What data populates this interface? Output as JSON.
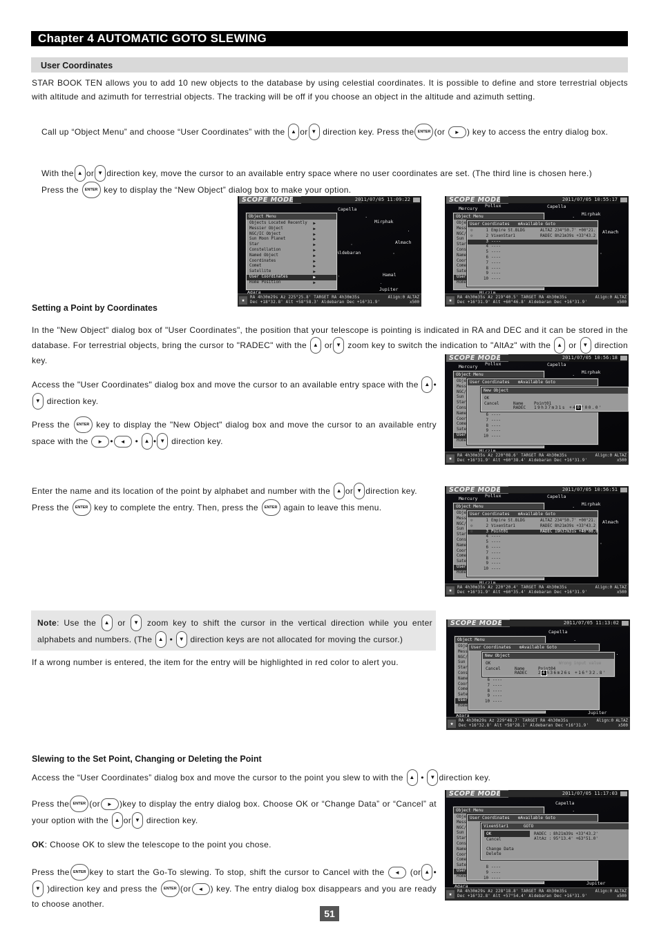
{
  "chapter_title": "Chapter 4  AUTOMATIC GOTO SLEWING",
  "section_title": "User Coordinates",
  "keys": {
    "up": "▲",
    "down": "▼",
    "right": "►",
    "left": "◄",
    "enter": "ENTER"
  },
  "intro": "STAR BOOK TEN allows you to add 10 new objects to the database by using celestial coordinates.  It is possible to define and store terrestrial objects with altitude and azimuth for terrestrial objects.  The tracking will be off if you choose an object in the altitude and azimuth setting.",
  "step1": {
    "a": "Call up “Object Menu” and choose “User Coordinates” with the",
    "b": "or",
    "c": "direction key.  Press the",
    "d": "(or",
    "e": ") key to access the entry dialog box."
  },
  "step2": {
    "a": "With the",
    "b": "or",
    "c": "direction key, move the cursor to an available entry space where no user coordinates are set.  (The third line is chosen here.)",
    "d": "Press the",
    "e": "key to display the “New Object” dialog box to make your option."
  },
  "setting_heading": "Setting a Point by Coordinates",
  "setting": {
    "p1a": "In the \"New Object\" dialog box of \"User Coordinates\", the position that your telescope is pointing is indicated in RA and DEC and it can be stored in the database.  For terrestrial objects, bring the cursor to \"RADEC\" with the",
    "p1b": "or",
    "p1c": "zoom key to switch the indication to \"AltAz\" with the",
    "p1d": "or",
    "p1e": "direction key.",
    "p2a": "Access the \"User Coordinates\" dialog box and move the cursor to an available entry space with the",
    "p2b": "•",
    "p2c": "direction key.",
    "p3a": "Press the",
    "p3b": "key to display the \"New Object\" dialog box and move the cursor to an available entry space with the",
    "p3c": "•",
    "p3d": "direction key.",
    "p4a": "Enter the name and its location of the point by alphabet and number with the",
    "p4b": "or",
    "p4c": "direction key.",
    "p4d": "Press the",
    "p4e": "key to complete the entry.  Then, press the",
    "p4f": "again to leave this menu."
  },
  "note": {
    "label": "Note",
    "a": ": Use the",
    "b": "or",
    "c": "zoom key to shift the cursor in the vertical direction while you enter alphabets and numbers.  (The",
    "d": "•",
    "e": "direction keys are not allocated for moving the cursor.)"
  },
  "wrong_number": "If a wrong number is entered, the item for the entry will be highlighted in red color to alert you.",
  "slewing_heading": "Slewing to the Set Point, Changing or Deleting the Point",
  "slewing": {
    "p1a": "Access the “User Coordinates” dialog box and move the cursor to the point you slew to with the",
    "p1b": "•",
    "p1c": "direction key.",
    "p2a": "Press the",
    "p2b": "(or",
    "p2c": ")key to display the entry dialog box.  Choose OK or “Change Data” or “Cancel” at your option with the",
    "p2d": "or",
    "p2e": "direction key.",
    "ok_label": "OK",
    "ok_text": ": Choose OK to slew the telescope to the point you chose.",
    "p3a": "Press the",
    "p3b": "key to start the Go-To slewing.  To stop, shift the cursor to Cancel with the",
    "p3c": "(or",
    "p3d": "•",
    "p3e": ")direction key and press the",
    "p3f": "(or",
    "p3g": ") key.  The entry dialog box disappears and you are ready to choose another."
  },
  "page_number": "51",
  "screens": {
    "mode_label": "SCOPE MODE",
    "object_menu_title": "Object Menu",
    "object_menu_items": [
      "Objects Located Recently",
      "Messier Object",
      "NGC/IC Object",
      "Sun Moon Planet",
      "Star",
      "Constellation",
      "Named Object",
      "Coordinates",
      "Comet",
      "Satellite",
      "User Coordinates",
      "Home Position"
    ],
    "object_menu_short": [
      "Obje",
      "Mess",
      "NGC/",
      "Sun",
      "Star",
      "Cons",
      "Name",
      "Coor",
      "Come",
      "Sate",
      "User",
      "Home"
    ],
    "uc_title": "User Coordinates",
    "uc_available": "Available Goto",
    "star_labels": [
      "Capella",
      "Mirphak",
      "Almach",
      "Aldebaran",
      "Hamal",
      "Jupiter",
      "Adara",
      "Mercury",
      "Pollux",
      "Mirzim"
    ],
    "s1": {
      "clock": "2011/07/05 11:09:22",
      "status_row1": "RA  4h30m29s  Az 225°25.8'     TARGET   RA  4h30m35s",
      "status_row2": "Dec +18°32.8'  Alt +58°58.3'  Aldebaran Dec +16°31.9'",
      "align": "Align:0  ALTAZ",
      "zoom": "x500",
      "selected_index": 10
    },
    "s2": {
      "clock": "2011/07/05 10:55:17",
      "status_row1": "RA  4h30m35s  Az 219°40.5'     TARGET   RA  4h30m35s",
      "status_row2": "Dec +16°31.9'  Alt +60°46.8'  Aldebaran Dec +16°31.9'",
      "align": "Align:0  ALTAZ",
      "zoom": "x500",
      "entries": [
        {
          "num": "1",
          "name": "Empire St.BLDG",
          "coord": "ALTAZ  234°50.7'  +00°21."
        },
        {
          "num": "2",
          "name": "VixenStar1",
          "coord": "RADEC   8h21m39s  +33°43.2"
        },
        {
          "num": "3",
          "name": "----",
          "coord": ""
        },
        {
          "num": "4",
          "name": "----",
          "coord": ""
        },
        {
          "num": "5",
          "name": "----",
          "coord": ""
        },
        {
          "num": "6",
          "name": "----",
          "coord": ""
        },
        {
          "num": "7",
          "name": "----",
          "coord": ""
        },
        {
          "num": "8",
          "name": "----",
          "coord": ""
        },
        {
          "num": "9",
          "name": "----",
          "coord": ""
        },
        {
          "num": "10",
          "name": "----",
          "coord": ""
        }
      ],
      "selected_index": 2
    },
    "s3": {
      "clock": "2011/07/05 10:56:18",
      "status_row1": "RA  4h30m35s  Az 220°08.6'     TARGET   RA  4h30m35s",
      "status_row2": "Dec +16°31.9'  Alt +60°38.4'  Aldebaran Dec +16°31.9'",
      "align": "Align:0  ALTAZ",
      "zoom": "x500",
      "new_object_title": "New Object",
      "ok": "OK",
      "cancel": "Cancel",
      "name_label": "Name",
      "name_value": "Point01",
      "radec_label": "RADEC",
      "radec_before": "19h37m31s +4",
      "radec_cursor": "0",
      "radec_after": "°00.0'"
    },
    "s4": {
      "clock": "2011/07/05 10:56:51",
      "status_row1": "RA  4h30m35s  Az 220°20.4'     TARGET   RA  4h30m35s",
      "status_row2": "Dec +16°31.9'  Alt +60°35.4'  Aldebaran Dec +16°31.9'",
      "align": "Align:0  ALTAZ",
      "zoom": "x500",
      "entries": [
        {
          "num": "1",
          "name": "Empire St.BLDG",
          "coord": "ALTAZ  234°50.7'  +00°21."
        },
        {
          "num": "2",
          "name": "VixenStar1",
          "coord": "RADEC   8h21m39s  +33°43.2"
        },
        {
          "num": "3",
          "name": "Point01",
          "coord": "RADEC  19h37m31s  +40°00.0"
        },
        {
          "num": "4",
          "name": "----",
          "coord": ""
        },
        {
          "num": "5",
          "name": "----",
          "coord": ""
        },
        {
          "num": "6",
          "name": "----",
          "coord": ""
        },
        {
          "num": "7",
          "name": "----",
          "coord": ""
        },
        {
          "num": "8",
          "name": "----",
          "coord": ""
        },
        {
          "num": "9",
          "name": "----",
          "coord": ""
        },
        {
          "num": "10",
          "name": "----",
          "coord": ""
        }
      ],
      "selected_index": 2
    },
    "s5": {
      "clock": "2011/07/05 11:13:02",
      "status_row1": "RA  4h30m29s  Az 229°48.7'     TARGET   RA  4h30m35s",
      "status_row2": "Dec +16°32.8'  Alt +58°28.1'  Aldebaran Dec +16°31.9'",
      "align": "Align:0  ALTAZ",
      "zoom": "x500",
      "new_object_title": "New Object",
      "ok": "OK",
      "cancel": "Cancel",
      "name_label": "Name",
      "name_value": "Point04",
      "radec_label": "RADEC",
      "radec_before": "2",
      "radec_cursor": "4",
      "radec_after": "h36m26s +16°32.8'",
      "hint": "Wrong input value"
    },
    "s6": {
      "clock": "2011/07/05 11:17:03",
      "status_row1": "RA  4h30m29s  Az 228°18.8'     TARGET   RA  4h30m35s",
      "status_row2": "Dec +16°32.8'  Alt +57°54.4'  Aldebaran Dec +16°31.9'",
      "align": "Align:0  ALTAZ",
      "zoom": "x500",
      "dialog_title": "VixenStar1",
      "dialog_mode": "GOTO",
      "options": [
        "OK",
        "Cancel",
        "Change Data",
        "Delete"
      ],
      "radec_label": "RADEC :",
      "radec_value": "8h21m39s +33°43.2'",
      "altaz_label": "AltAz :",
      "altaz_value": "95°13.4'  +63°51.0'"
    }
  }
}
